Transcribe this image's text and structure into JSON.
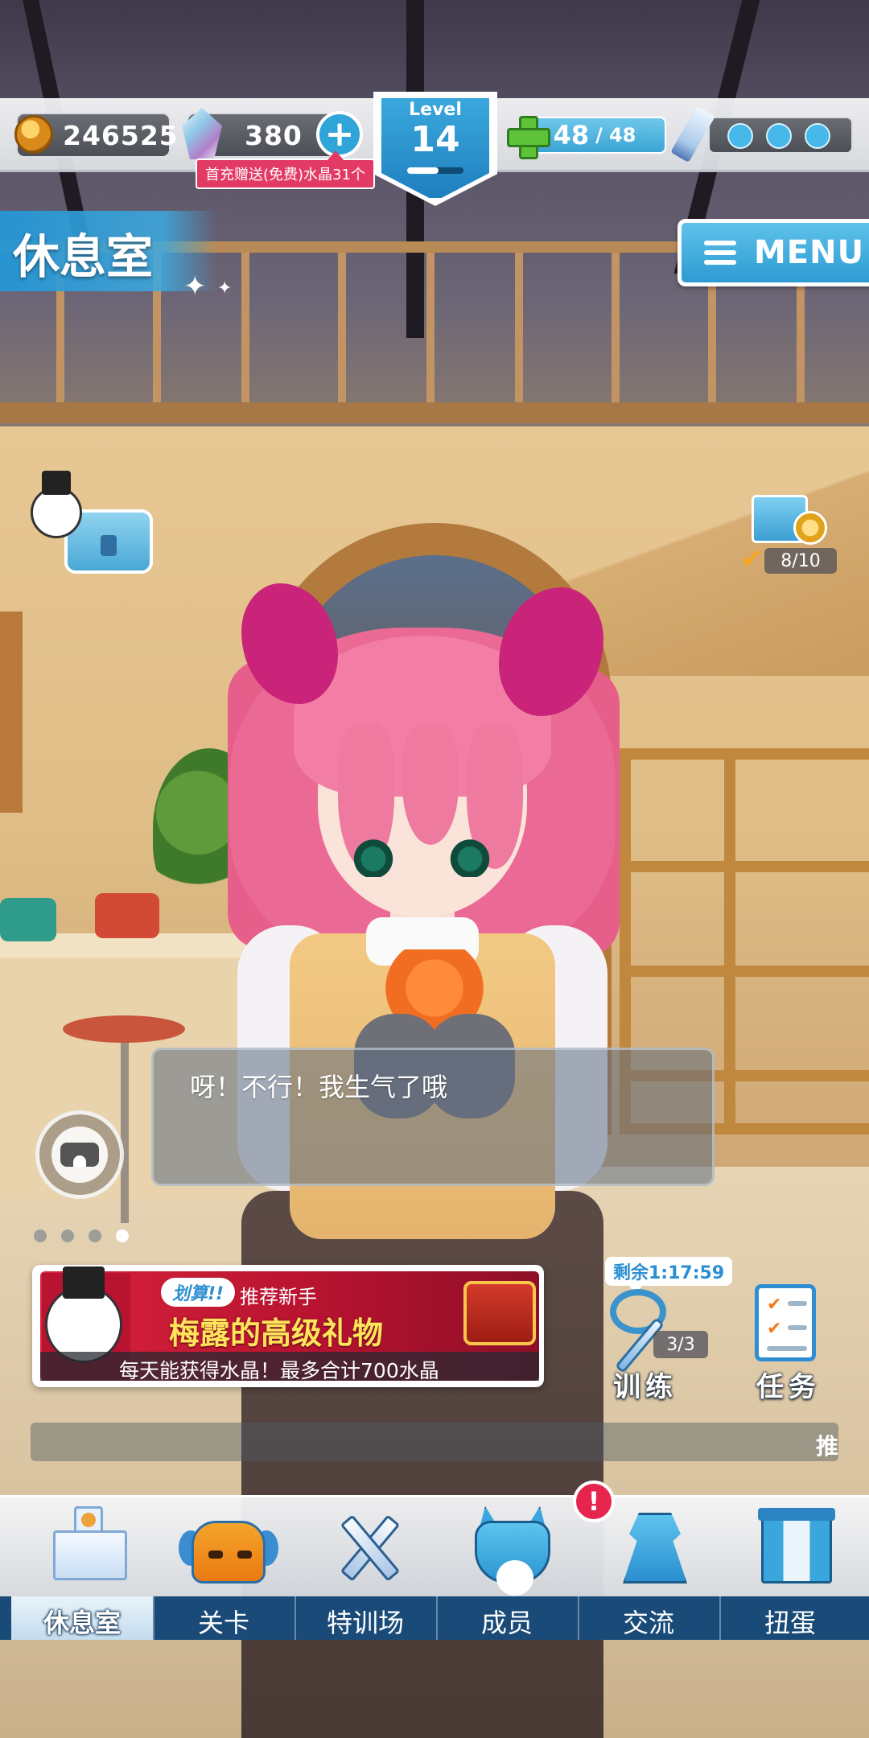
{
  "hud": {
    "coins": "246525",
    "crystals": "380",
    "add_label": "+",
    "promo": "首充赠送(免费)水晶31个",
    "level_label": "Level",
    "level_value": "14",
    "level_progress": 0.55,
    "stamina_current": "48",
    "stamina_separator": "/",
    "stamina_max": "48",
    "battle_pips": 3,
    "battle_pips_filled": 3
  },
  "room": {
    "title": "休息室",
    "menu_label": "MENU"
  },
  "widgets": {
    "gift_progress": "8/10"
  },
  "dialog": {
    "text": "呀！不行！我生气了哦"
  },
  "pager": {
    "count": 4,
    "active_index": 3
  },
  "banner": {
    "tag": "划算!!",
    "subtitle": "推荐新手",
    "title": "梅露的高级礼物",
    "caption": "每天能获得水晶！最多合计700水晶"
  },
  "training": {
    "timer": "剩余1:17:59",
    "count": "3/3",
    "label": "训练"
  },
  "tasks": {
    "label": "任务"
  },
  "ticker": {
    "text": "推"
  },
  "nav": {
    "items": [
      {
        "label": "休息室",
        "icon": "school-icon",
        "active": true
      },
      {
        "label": "关卡",
        "icon": "demon-icon",
        "active": false
      },
      {
        "label": "特训场",
        "icon": "crossed-swords-icon",
        "active": false
      },
      {
        "label": "成员",
        "icon": "mask-icon",
        "active": false
      },
      {
        "label": "交流",
        "icon": "dress-icon",
        "active": false,
        "badge": "!"
      },
      {
        "label": "扭蛋",
        "icon": "curtain-icon",
        "active": false
      }
    ]
  },
  "colors": {
    "accent_blue": "#2d9bd3",
    "alert_red": "#e6244d",
    "nav_bar": "#1a4b78",
    "banner_red": "#d9233b",
    "title_yellow": "#ffe45a"
  }
}
